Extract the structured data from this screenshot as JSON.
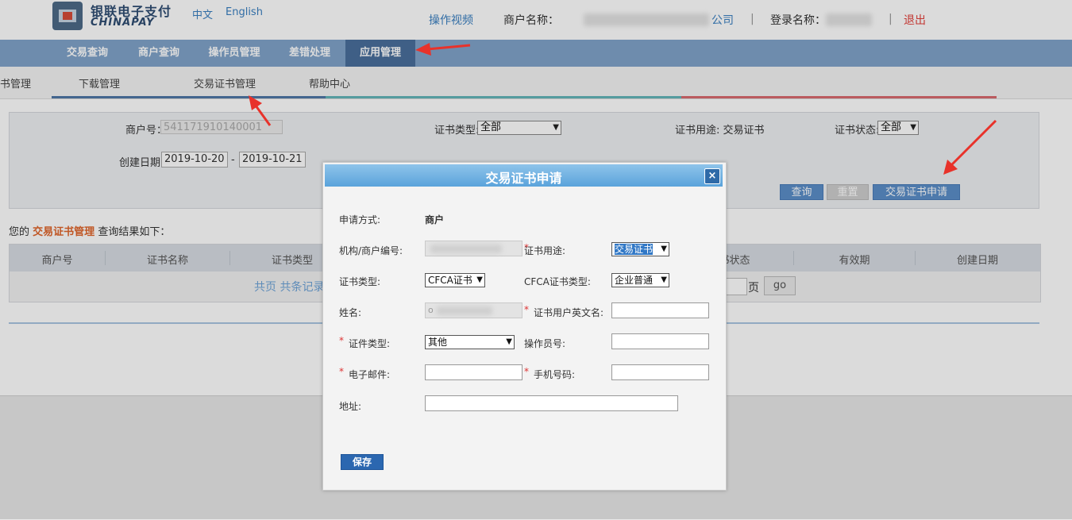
{
  "header": {
    "logo_cn": "银联电子支付",
    "logo_en": "CHINAPAY",
    "lang_cn": "中文",
    "lang_en": "English",
    "help_video": "操作视频",
    "merchant_label": "商户名称：",
    "merchant_suffix": "公司",
    "separator": "|",
    "login_label": "登录名称：",
    "logout": "退出"
  },
  "main_nav": {
    "items": [
      {
        "label": "交易查询"
      },
      {
        "label": "商户查询"
      },
      {
        "label": "操作员管理"
      },
      {
        "label": "差错处理"
      },
      {
        "label": "应用管理",
        "active": true
      }
    ]
  },
  "sub_nav": {
    "items": [
      {
        "label": "书管理"
      },
      {
        "label": "下载管理"
      },
      {
        "label": "交易证书管理"
      },
      {
        "label": "帮助中心"
      }
    ]
  },
  "search": {
    "merchant_no_label": "商户号：",
    "merchant_no_value": "541171910140001",
    "cert_type_label": "证书类型:",
    "cert_type_value": "全部",
    "cert_usage_label": "证书用途: 交易证书",
    "cert_status_label": "证书状态:",
    "cert_status_value": "全部",
    "create_date_label": "创建日期:",
    "date_from": "2019-10-20",
    "date_dash": "-",
    "date_to": "2019-10-21",
    "query_button": "查询",
    "reset_button": "重置",
    "apply_button": "交易证书申请"
  },
  "result": {
    "caption_prefix": "您的",
    "caption_highlight": "交易证书管理",
    "caption_suffix": "查询结果如下：",
    "columns": [
      "商户号",
      "证书名称",
      "证书类型",
      "书状态",
      "有效期",
      "创建日期"
    ],
    "pager_text": "共页 共条记录",
    "page_suffix": "页",
    "go_button": "go"
  },
  "modal": {
    "title": "交易证书申请",
    "close": "×",
    "apply_method_label": "申请方式:",
    "apply_method_value": "商户",
    "org_merchant_no_label": "机构/商户编号:",
    "cert_usage_label": "证书用途:",
    "cert_usage_value": "交易证书",
    "cert_type_label": "证书类型:",
    "cert_type_value": "CFCA证书",
    "cfca_type_label": "CFCA证书类型:",
    "cfca_type_value": "企业普通",
    "name_label": "姓名:",
    "name_value_partial": "o",
    "required_mark": "*",
    "cert_user_en_label": "证书用户英文名:",
    "id_type_label": "证件类型:",
    "id_type_value": "其他",
    "operator_no_label": "操作员号:",
    "email_label": "电子邮件:",
    "mobile_label": "手机号码:",
    "address_label": "地址:",
    "save_button": "保存"
  },
  "colors": {
    "nav_bg": "#80a4ca",
    "nav_active": "#4a6f9c",
    "modal_title": "#5aa3db",
    "link": "#3a7fc0",
    "highlight": "#e0652b",
    "logout": "#e2403b",
    "annotation_arrow": "#e8322a"
  }
}
